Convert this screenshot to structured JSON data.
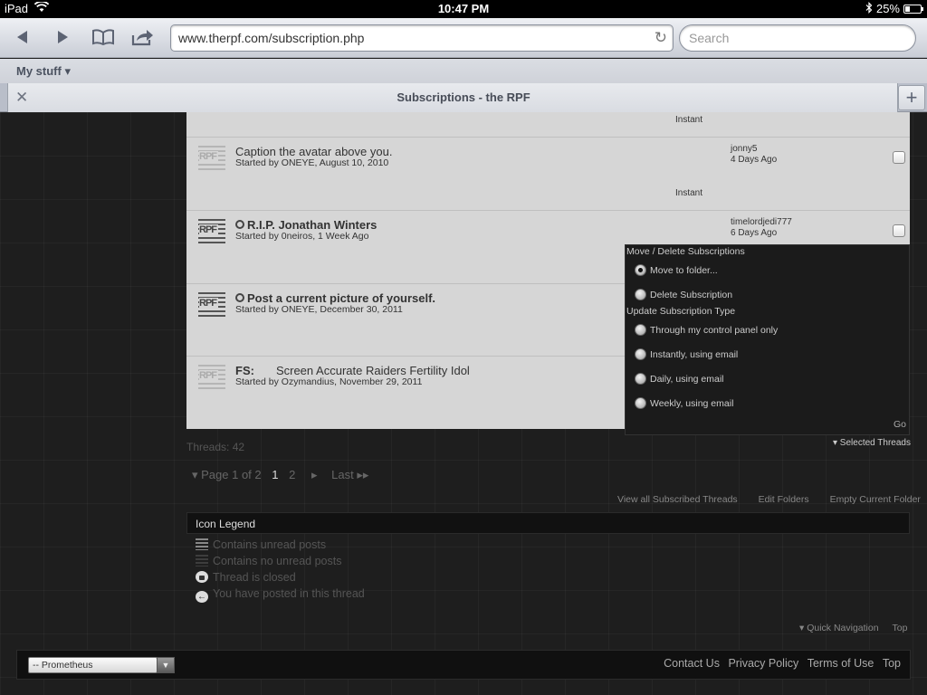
{
  "status_bar": {
    "device": "iPad",
    "time": "10:47 PM",
    "battery": "25%"
  },
  "browser": {
    "url": "www.therpf.com/subscription.php",
    "search_placeholder": "Search",
    "bookmark_folder": "My stuff ▾",
    "tab_title": "Subscriptions - the RPF"
  },
  "threads": {
    "top_notify": "Instant",
    "rows": [
      {
        "title": "Caption the avatar above you.",
        "starter": "Started by ONEYE, August 10, 2010",
        "last_poster": "jonny5",
        "last_date": "4 Days Ago",
        "notify": "Instant"
      },
      {
        "title": "R.I.P. Jonathan Winters",
        "starter": "Started by 0neiros, 1 Week Ago",
        "last_poster": "timelordjedi777",
        "last_date": "6 Days Ago"
      },
      {
        "title": "Post a current picture of yourself.",
        "starter": "Started by ONEYE, December 30, 2011"
      },
      {
        "prefix": "FS:",
        "title": "Screen Accurate Raiders Fertility Idol",
        "starter": "Started by Ozymandius, November 29, 2011"
      }
    ],
    "count": "Threads: 42"
  },
  "menu": {
    "move_header": "Move / Delete Subscriptions",
    "move_to_folder": "Move to folder...",
    "delete": "Delete Subscription",
    "update_header": "Update Subscription Type",
    "control_panel": "Through my control panel only",
    "instant_email": "Instantly, using email",
    "daily_email": "Daily, using email",
    "weekly_email": "Weekly, using email",
    "go": "Go"
  },
  "selected_threads": "▾ Selected Threads",
  "pagination": {
    "label": "▾ Page 1 of 2",
    "page1": "1",
    "page2": "2",
    "next": "▸",
    "last": "Last ▸▸"
  },
  "links": {
    "view_all": "View all Subscribed Threads",
    "edit_folders": "Edit Folders",
    "empty_folder": "Empty Current Folder"
  },
  "legend": {
    "title": "Icon Legend",
    "unread": "Contains unread posts",
    "no_unread": "Contains no unread posts",
    "closed": "Thread is closed",
    "posted": "You have posted in this thread"
  },
  "quick_nav": {
    "label": "▾ Quick Navigation",
    "top": "Top"
  },
  "footer": {
    "style": "-- Prometheus",
    "contact": "Contact Us",
    "privacy": "Privacy Policy",
    "terms": "Terms of Use",
    "top": "Top"
  }
}
